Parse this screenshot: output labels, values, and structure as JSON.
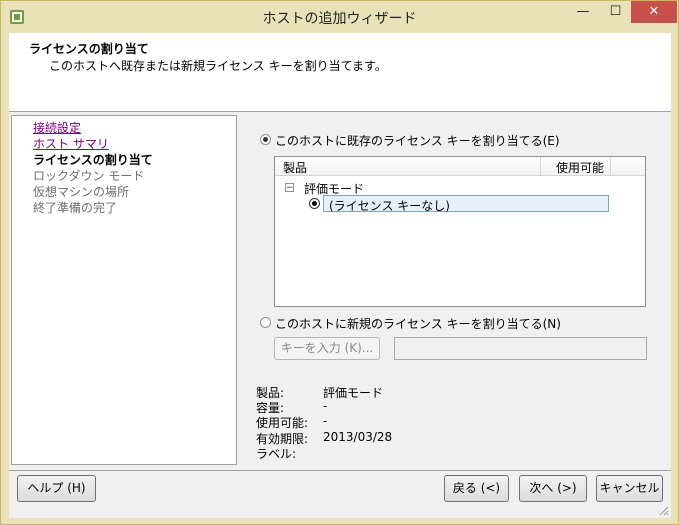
{
  "window": {
    "title": "ホストの追加ウィザード",
    "controls": {
      "minimize": "—",
      "maximize": "☐",
      "close": "✕"
    }
  },
  "header": {
    "title": "ライセンスの割り当て",
    "description": "このホストへ既存または新規ライセンス キーを割り当てます。"
  },
  "nav": {
    "items": [
      {
        "label": "接続設定",
        "state": "link"
      },
      {
        "label": "ホスト サマリ",
        "state": "link"
      },
      {
        "label": "ライセンスの割り当て",
        "state": "current"
      },
      {
        "label": "ロックダウン モード",
        "state": "disabled"
      },
      {
        "label": "仮想マシンの場所",
        "state": "disabled"
      },
      {
        "label": "終了準備の完了",
        "state": "disabled"
      }
    ]
  },
  "license": {
    "existing_option": {
      "label": "このホストに既存のライセンス キーを割り当てる(E)",
      "checked": true
    },
    "grid": {
      "col_product": "製品",
      "col_available": "使用可能",
      "group": {
        "toggle": "−",
        "label": "評価モード"
      },
      "selected_item": "(ライセンス キーなし)"
    },
    "new_option": {
      "label": "このホストに新規のライセンス キーを割り当てる(N)",
      "checked": false
    },
    "enter_key_button": "キーを入力 (K)...",
    "key_field_value": ""
  },
  "details": {
    "product_label": "製品:",
    "product_value": "評価モード",
    "capacity_label": "容量:",
    "capacity_value": "-",
    "available_label": "使用可能:",
    "available_value": "-",
    "expiry_label": "有効期限:",
    "expiry_value": "2013/03/28",
    "label_label": "ラベル:",
    "label_value": ""
  },
  "footer": {
    "help": "ヘルプ (H)",
    "back": "戻る (<)",
    "next": "次へ (>)",
    "cancel": "キャンセル"
  },
  "colors": {
    "frame": "#e9e1b7",
    "close_button": "#c7504b",
    "visited_link": "#800080",
    "selection_border": "#7da2ce"
  }
}
